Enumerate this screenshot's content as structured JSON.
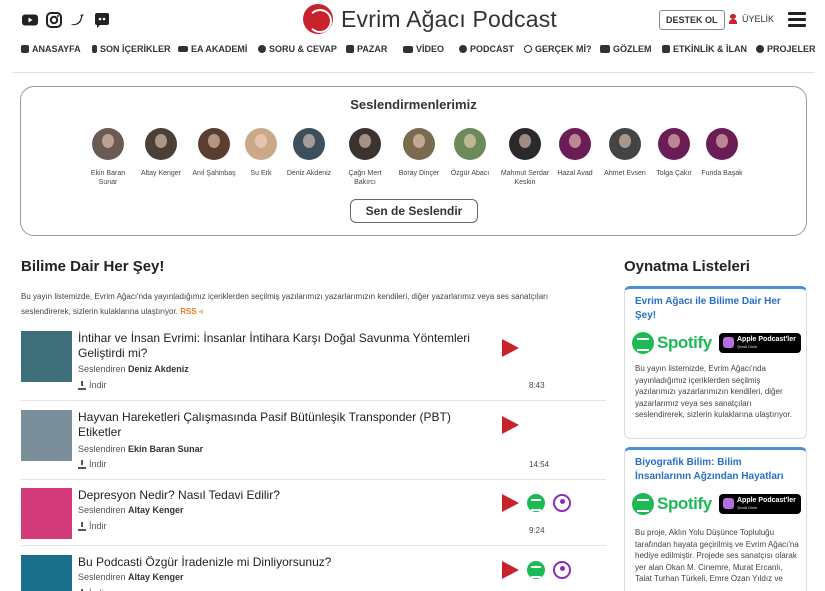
{
  "header": {
    "brand_title": "Evrim Ağacı Podcast",
    "support_label": "DESTEK OL",
    "member_label": "ÜYELİK",
    "social_icons": [
      "youtube-icon",
      "instagram-icon",
      "twitter-icon",
      "discord-icon"
    ]
  },
  "nav": {
    "items": [
      {
        "label": "ANASAYFA",
        "icon": "home-icon"
      },
      {
        "label": "SON İÇERİKLER",
        "icon": "bolt-icon"
      },
      {
        "label": "EA AKADEMİ",
        "icon": "graduation-cap-icon"
      },
      {
        "label": "SORU & CEVAP",
        "icon": "question-circle-icon"
      },
      {
        "label": "PAZAR",
        "icon": "store-icon"
      },
      {
        "label": "VİDEO",
        "icon": "video-icon"
      },
      {
        "label": "PODCAST",
        "icon": "podcast-icon"
      },
      {
        "label": "GERÇEK Mİ?",
        "icon": "check-circle-icon"
      },
      {
        "label": "GÖZLEM",
        "icon": "binoculars-icon"
      },
      {
        "label": "ETKİNLİK & İLAN",
        "icon": "calendar-icon"
      },
      {
        "label": "PROJELER",
        "icon": "brain-icon"
      }
    ]
  },
  "narrators": {
    "title": "Seslendirmenlerimiz",
    "button_label": "Sen de Seslendir",
    "people": [
      {
        "name": "Ekin Baran Sunar",
        "color": "#6b5a52"
      },
      {
        "name": "Altay Kenger",
        "color": "#4a4038"
      },
      {
        "name": "Anıl Şahinbaş",
        "color": "#5a3e30"
      },
      {
        "name": "Su Erk",
        "color": "#c9a98a"
      },
      {
        "name": "Deniz Akdeniz",
        "color": "#3d4e5c"
      },
      {
        "name": "Çağrı Mert Bakırcı",
        "color": "#3a3330"
      },
      {
        "name": "Boray Dinçer",
        "color": "#7a6a50"
      },
      {
        "name": "Özgür Abacı",
        "color": "#6d8a5a"
      },
      {
        "name": "Mahmut Serdar Keskin",
        "color": "#2a2a2a"
      },
      {
        "name": "Hazal Avad",
        "color": "#6a1e55"
      },
      {
        "name": "Ahmet Evsen",
        "color": "#444444"
      },
      {
        "name": "Tolga Çakır",
        "color": "#6a1e55"
      },
      {
        "name": "Funda Başak",
        "color": "#6a1e55"
      }
    ]
  },
  "main": {
    "title": "Bilime Dair Her Şey!",
    "intro": "Bu yayın listemizde, Evrim Ağacı'nda yayınladığımız içeriklerden seçilmiş yazılarımızı yazarlarımızın kendileri, diğer yazarlarımız veya ses sanatçıları seslendirerek, sizlerin kulaklarına ulaştırıyor.",
    "rss_label": "RSS",
    "narrated_by": "Seslendiren",
    "download_label": "İndir",
    "episodes": [
      {
        "title": "İntihar ve İnsan Evrimi: İnsanlar İntihara Karşı Doğal Savunma Yöntemleri Geliştirdi mi?",
        "narrator": "Deniz Akdeniz",
        "duration": "8:43",
        "thumb": "#3f6f7a"
      },
      {
        "title": "Hayvan Hareketleri Çalışmasında Pasif Bütünleşik Transponder (PBT) Etiketler",
        "narrator": "Ekin Baran Sunar",
        "duration": "14:54",
        "thumb": "#7a8f9a"
      },
      {
        "title": "Depresyon Nedir? Nasıl Tedavi Edilir?",
        "narrator": "Altay Kenger",
        "duration": "9:24",
        "thumb": "#d23a7a"
      },
      {
        "title": "Bu Podcasti Özgür İradenizle mi Dinliyorsunuz?",
        "narrator": "Altay Kenger",
        "duration": "",
        "thumb": "#1a6f8a"
      }
    ]
  },
  "sidebar": {
    "title": "Oynatma Listeleri",
    "spotify_label": "Spotify",
    "apple_label": "Apple Podcast'ler",
    "apple_sub": "Şimdi Dinle",
    "playlists": [
      {
        "title": "Evrim Ağacı ile Bilime Dair Her Şey!",
        "desc": "Bu yayın listemizde, Evrim Ağacı'nda yayınladığımız içeriklerden seçilmiş yazılarımızı yazarlarımızın kendileri, diğer yazarlarımız veya ses sanatçıları seslendirerek, sizlerin kulaklarına ulaştırıyor."
      },
      {
        "title": "Biyografik Bilim: Bilim İnsanlarının Ağzından Hayatları",
        "desc": "Bu proje, Aklın Yolu Düşünce Topluluğu tarafından hayata geçirilmiş ve Evrim Ağacı'na hediye edilmiştir. Projede ses sanatçısı olarak yer alan Okan M. Cinemre, Murat Ercanlı, Talat Turhan Türkeli, Emre Ozan Yıldız ve"
      }
    ]
  }
}
